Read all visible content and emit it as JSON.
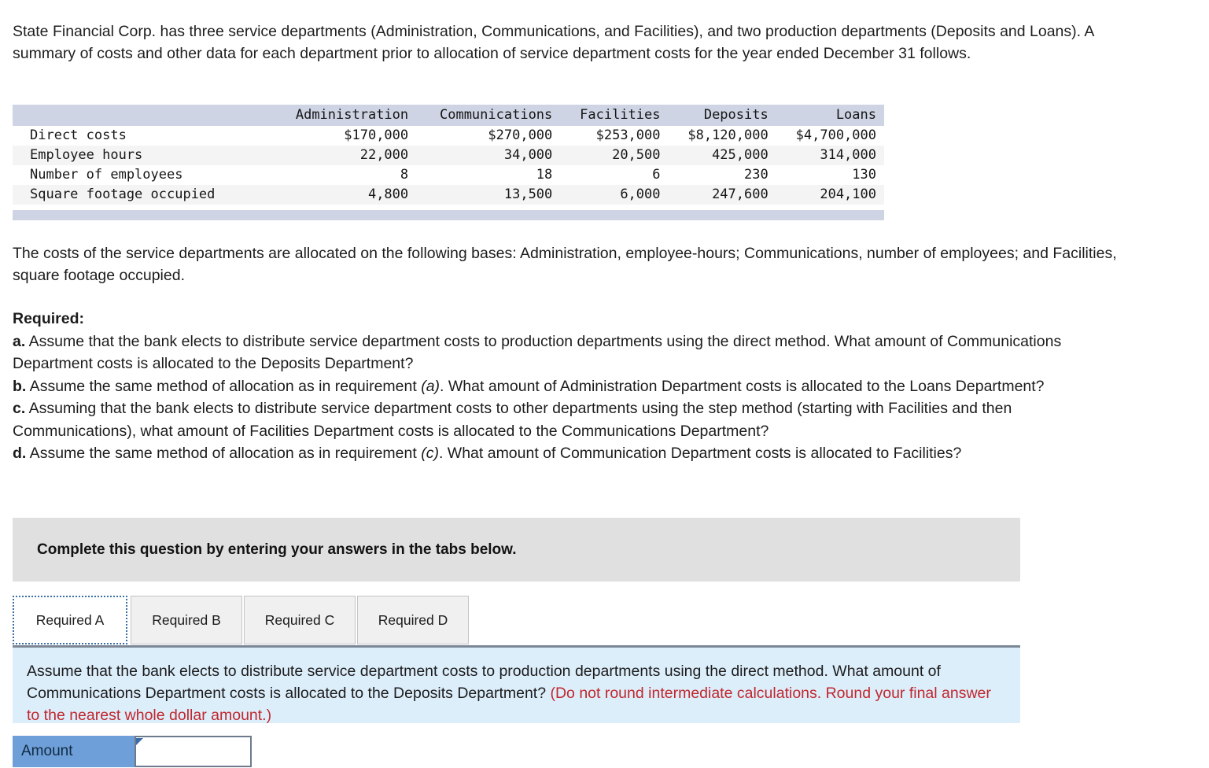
{
  "intro": "State Financial Corp. has three service departments (Administration, Communications, and Facilities), and two production departments (Deposits and Loans). A summary of costs and other data for each department prior to allocation of service department costs for the year ended December 31 follows.",
  "table": {
    "corner_label": "",
    "columns": [
      "Administration",
      "Communications",
      "Facilities",
      "Deposits",
      "Loans"
    ],
    "rows": [
      {
        "label": "Direct costs",
        "values": [
          "$170,000",
          "$270,000",
          "$253,000",
          "$8,120,000",
          "$4,700,000"
        ]
      },
      {
        "label": "Employee hours",
        "values": [
          "22,000",
          "34,000",
          "20,500",
          "425,000",
          "314,000"
        ]
      },
      {
        "label": "Number of employees",
        "values": [
          "8",
          "18",
          "6",
          "230",
          "130"
        ]
      },
      {
        "label": "Square footage occupied",
        "values": [
          "4,800",
          "13,500",
          "6,000",
          "247,600",
          "204,100"
        ]
      }
    ]
  },
  "bases_text": "The costs of the service departments are allocated on the following bases: Administration, employee-hours; Communications, number of employees; and Facilities, square footage occupied.",
  "required": {
    "title": "Required:",
    "items": [
      {
        "letter": "a.",
        "text_before": " Assume that the bank elects to distribute service department costs to production departments using the direct method. What amount of Communications Department costs is allocated to the Deposits Department?",
        "italic": "",
        "text_after": ""
      },
      {
        "letter": "b.",
        "text_before": " Assume the same method of allocation as in requirement ",
        "italic": "(a)",
        "text_after": ". What amount of Administration Department costs is allocated to the Loans Department?"
      },
      {
        "letter": "c.",
        "text_before": " Assuming that the bank elects to distribute service department costs to other departments using the step method (starting with Facilities and then Communications), what amount of Facilities Department costs is allocated to the Communications Department?",
        "italic": "",
        "text_after": ""
      },
      {
        "letter": "d.",
        "text_before": " Assume the same method of allocation as in requirement ",
        "italic": "(c)",
        "text_after": ". What amount of Communication Department costs is allocated to Facilities?"
      }
    ]
  },
  "banner": {
    "text": "Complete this question by entering your answers in the tabs below."
  },
  "tabs": {
    "items": [
      {
        "label": "Required A",
        "active": true
      },
      {
        "label": "Required B",
        "active": false
      },
      {
        "label": "Required C",
        "active": false
      },
      {
        "label": "Required D",
        "active": false
      }
    ]
  },
  "question_panel": {
    "body": "Assume that the bank elects to distribute service department costs to production departments using the direct method. What amount of Communications Department costs is allocated to the Deposits Department? ",
    "note": "(Do not round intermediate calculations. Round your final answer to the nearest whole dollar amount.)"
  },
  "answer_row": {
    "label": "Amount",
    "value": "",
    "placeholder": ""
  },
  "colors": {
    "table_header_bg": "#ced4e4",
    "banner_bg": "#e0e0e0",
    "panel_bg": "#ddeefb",
    "note_red": "#c1272d",
    "amount_label_bg": "#6f9fd8",
    "tab_active_outline": "#3a6ea5"
  }
}
